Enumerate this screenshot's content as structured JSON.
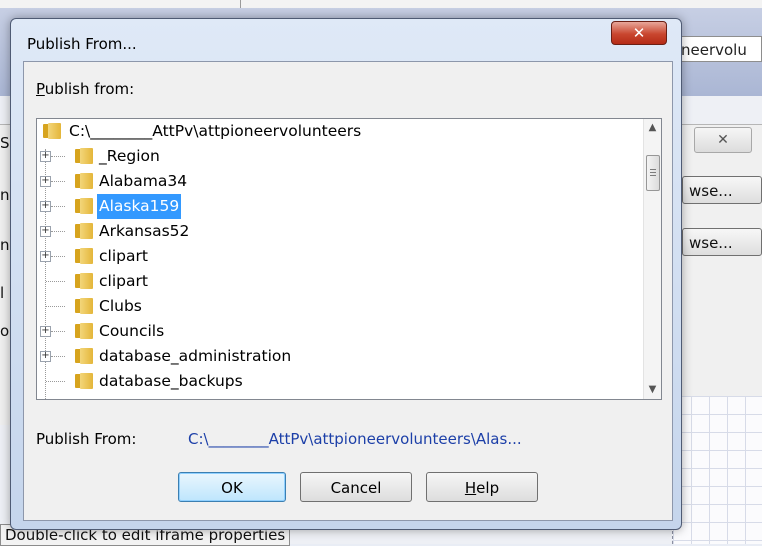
{
  "background": {
    "url_fragment": "neervolu",
    "browse_1": "wse...",
    "browse_2": "wse...",
    "close_glyph": "✕",
    "edge_chars": [
      "S",
      "n",
      "n",
      "l",
      "o"
    ],
    "status_text": "Double-click to edit iframe properties"
  },
  "dialog": {
    "title": "Publish From...",
    "close_glyph": "✕",
    "publish_from_label_u": "P",
    "publish_from_label_rest": "ublish from:",
    "tree": {
      "root": "C:\\________AttPv\\attpioneervolunteers",
      "items": [
        {
          "label": "_Region",
          "expandable": true,
          "selected": false
        },
        {
          "label": "Alabama34",
          "expandable": true,
          "selected": false
        },
        {
          "label": "Alaska159",
          "expandable": true,
          "selected": true
        },
        {
          "label": "Arkansas52",
          "expandable": true,
          "selected": false
        },
        {
          "label": "clipart",
          "expandable": true,
          "selected": false
        },
        {
          "label": "clipart",
          "expandable": false,
          "selected": false
        },
        {
          "label": "Clubs",
          "expandable": false,
          "selected": false
        },
        {
          "label": "Councils",
          "expandable": true,
          "selected": false
        },
        {
          "label": "database_administration",
          "expandable": true,
          "selected": false
        },
        {
          "label": "database_backups",
          "expandable": false,
          "selected": false
        }
      ]
    },
    "publish_from_caption": "Publish From:",
    "publish_from_value": "C:\\________AttPv\\attpioneervolunteers\\Alas...",
    "buttons": {
      "ok": "OK",
      "cancel": "Cancel",
      "help_u": "H",
      "help_rest": "elp"
    }
  }
}
